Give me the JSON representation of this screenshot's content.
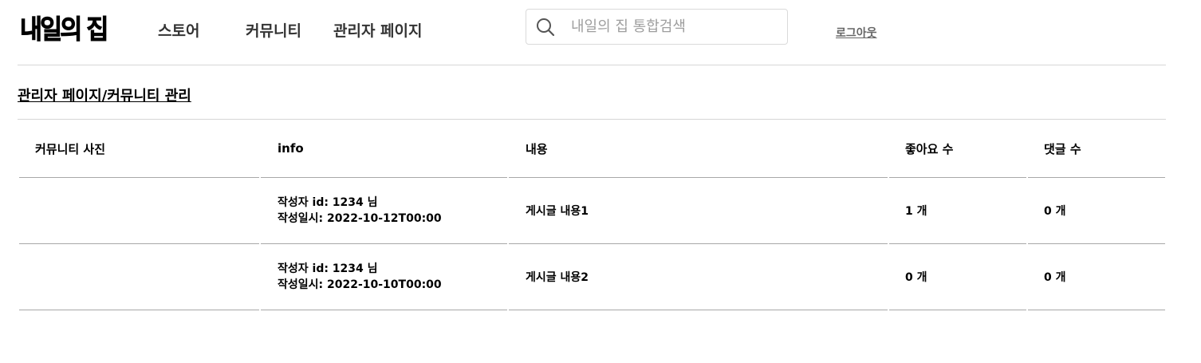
{
  "header": {
    "logo": "내일의 집",
    "nav": [
      "스토어",
      "커뮤니티",
      "관리자 페이지"
    ],
    "search": {
      "placeholder": "내일의 집 통합검색",
      "value": ""
    },
    "logout_label": "로그아웃"
  },
  "breadcrumb": "관리자 페이지/커뮤니티 관리",
  "table": {
    "columns": [
      "커뮤니티 사진",
      "info",
      "내용",
      "좋아요 수",
      "댓글 수"
    ],
    "rows": [
      {
        "photo": "",
        "author": "작성자 id: 1234 님",
        "created": "작성일시: 2022-10-12T00:00",
        "content": "게시글 내용1",
        "likes": "1 개",
        "comments": "0 개"
      },
      {
        "photo": "",
        "author": "작성자 id: 1234 님",
        "created": "작성일시: 2022-10-10T00:00",
        "content": "게시글 내용2",
        "likes": "0 개",
        "comments": "0 개"
      }
    ]
  }
}
